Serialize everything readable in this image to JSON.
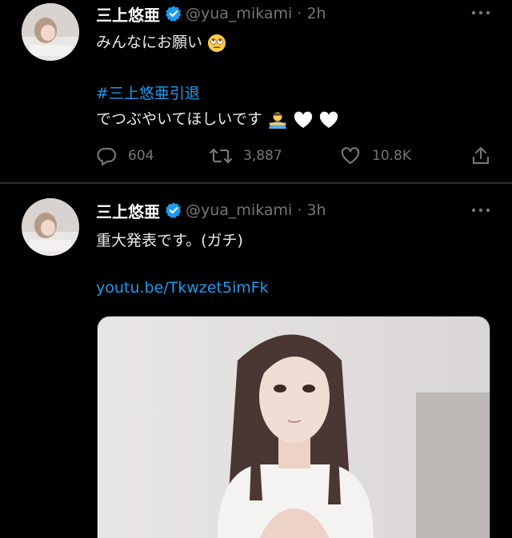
{
  "tweets": [
    {
      "name": "三上悠亜",
      "handle": "@yua_mikami",
      "time": "2h",
      "line1": "みんなにお願い",
      "hashtag": "#三上悠亜引退",
      "line2": "でつぶやいてほしいです",
      "replies": "604",
      "retweets": "3,887",
      "likes": "10.8K"
    },
    {
      "name": "三上悠亜",
      "handle": "@yua_mikami",
      "time": "3h",
      "line1": "重大発表です。(ガチ)",
      "link": "youtu.be/Tkwzet5imFk"
    }
  ],
  "colors": {
    "background": "#000000",
    "text": "#e7e9ea",
    "muted": "#71767b",
    "link": "#1d9bf0",
    "verified": "#1d9bf0"
  },
  "icons": [
    "verified-badge-icon",
    "more-icon",
    "reply-icon",
    "retweet-icon",
    "like-icon",
    "share-icon",
    "rolling-eyes-emoji",
    "person-bowing-emoji",
    "white-heart-emoji"
  ]
}
